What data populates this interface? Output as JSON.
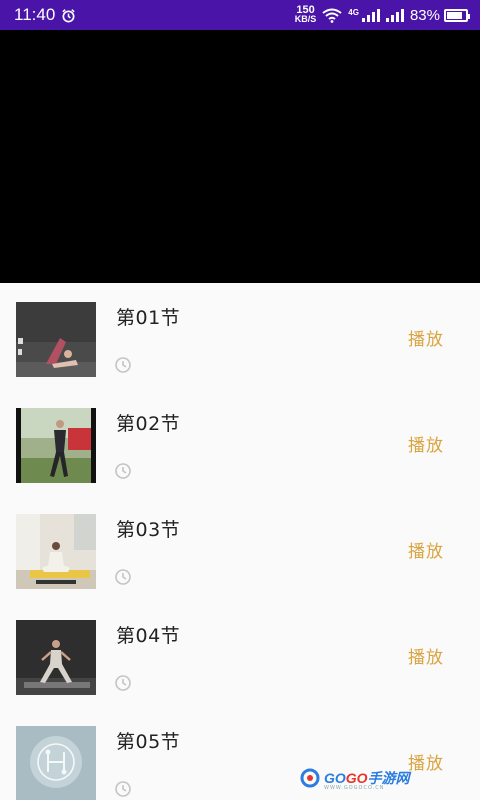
{
  "status_bar": {
    "time": "11:40",
    "net_speed_value": "150",
    "net_speed_unit": "KB/S",
    "network_type": "4G",
    "battery": "83%",
    "battery_level": 0.83
  },
  "video_player": {},
  "lessons": [
    {
      "title": "第01节",
      "action": "播放"
    },
    {
      "title": "第02节",
      "action": "播放"
    },
    {
      "title": "第03节",
      "action": "播放"
    },
    {
      "title": "第04节",
      "action": "播放"
    },
    {
      "title": "第05节",
      "action": "播放"
    }
  ],
  "watermark": {
    "brand_prefix": "GO",
    "brand_accent": "GO",
    "brand_suffix": "手游网",
    "url": "WWW.GOGOCO.CN"
  },
  "colors": {
    "status_bar": "#4a14a8",
    "play_accent": "#d9a43f",
    "background": "#fafafa"
  }
}
